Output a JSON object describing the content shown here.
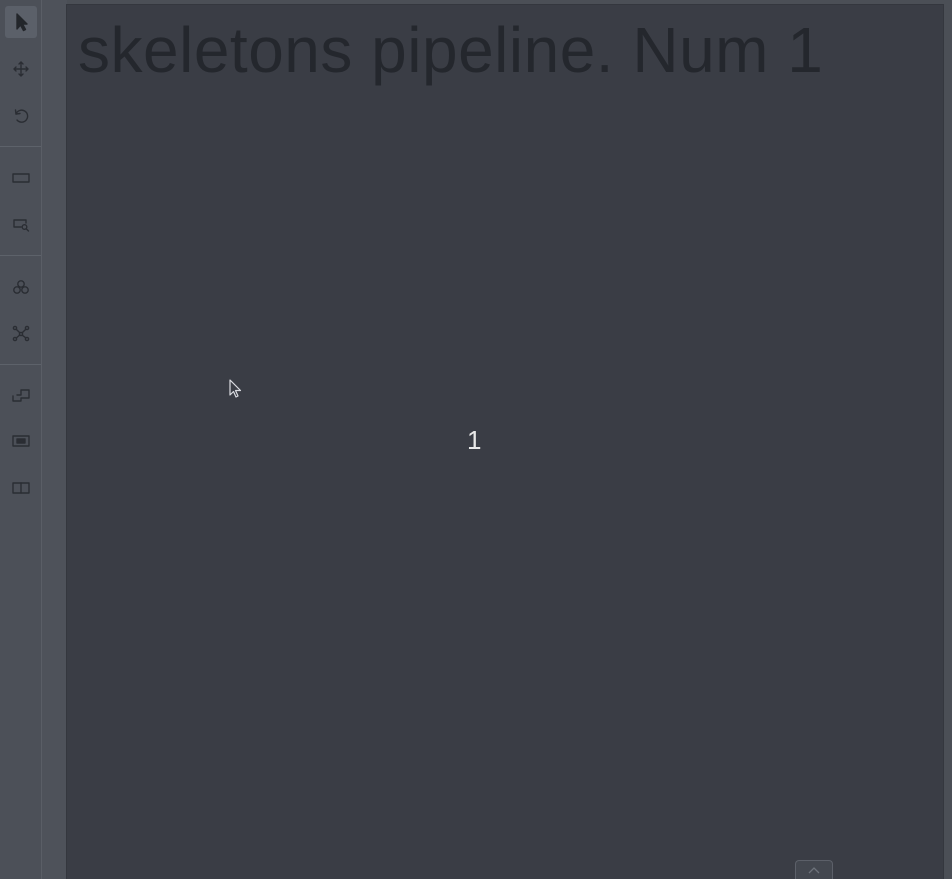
{
  "canvas": {
    "frame_title": "skeletons pipeline. Num 1",
    "point_label": "1"
  },
  "toolbar": {
    "tools": [
      {
        "name": "cursor-tool",
        "icon": "pointer-arrow-icon",
        "active": true
      },
      {
        "name": "move-tool",
        "icon": "move-arrows-icon"
      },
      {
        "name": "rotate-tool",
        "icon": "rotate-icon"
      },
      {
        "name": "fit-image-tool",
        "icon": "rectangle-icon"
      },
      {
        "name": "zoom-region-tool",
        "icon": "zoom-region-icon"
      },
      {
        "name": "openvino-tool",
        "icon": "openvino-icon"
      },
      {
        "name": "skeleton-tool",
        "icon": "skeleton-icon"
      },
      {
        "name": "merge-shapes-tool",
        "icon": "merge-icon"
      },
      {
        "name": "group-shapes-tool",
        "icon": "group-icon"
      },
      {
        "name": "split-track-tool",
        "icon": "split-icon"
      }
    ]
  },
  "colors": {
    "sidebar": "#4c5058",
    "canvas_bg": "#3a3d45",
    "title_text": "#24272d",
    "label_text": "#e8e8e8"
  }
}
